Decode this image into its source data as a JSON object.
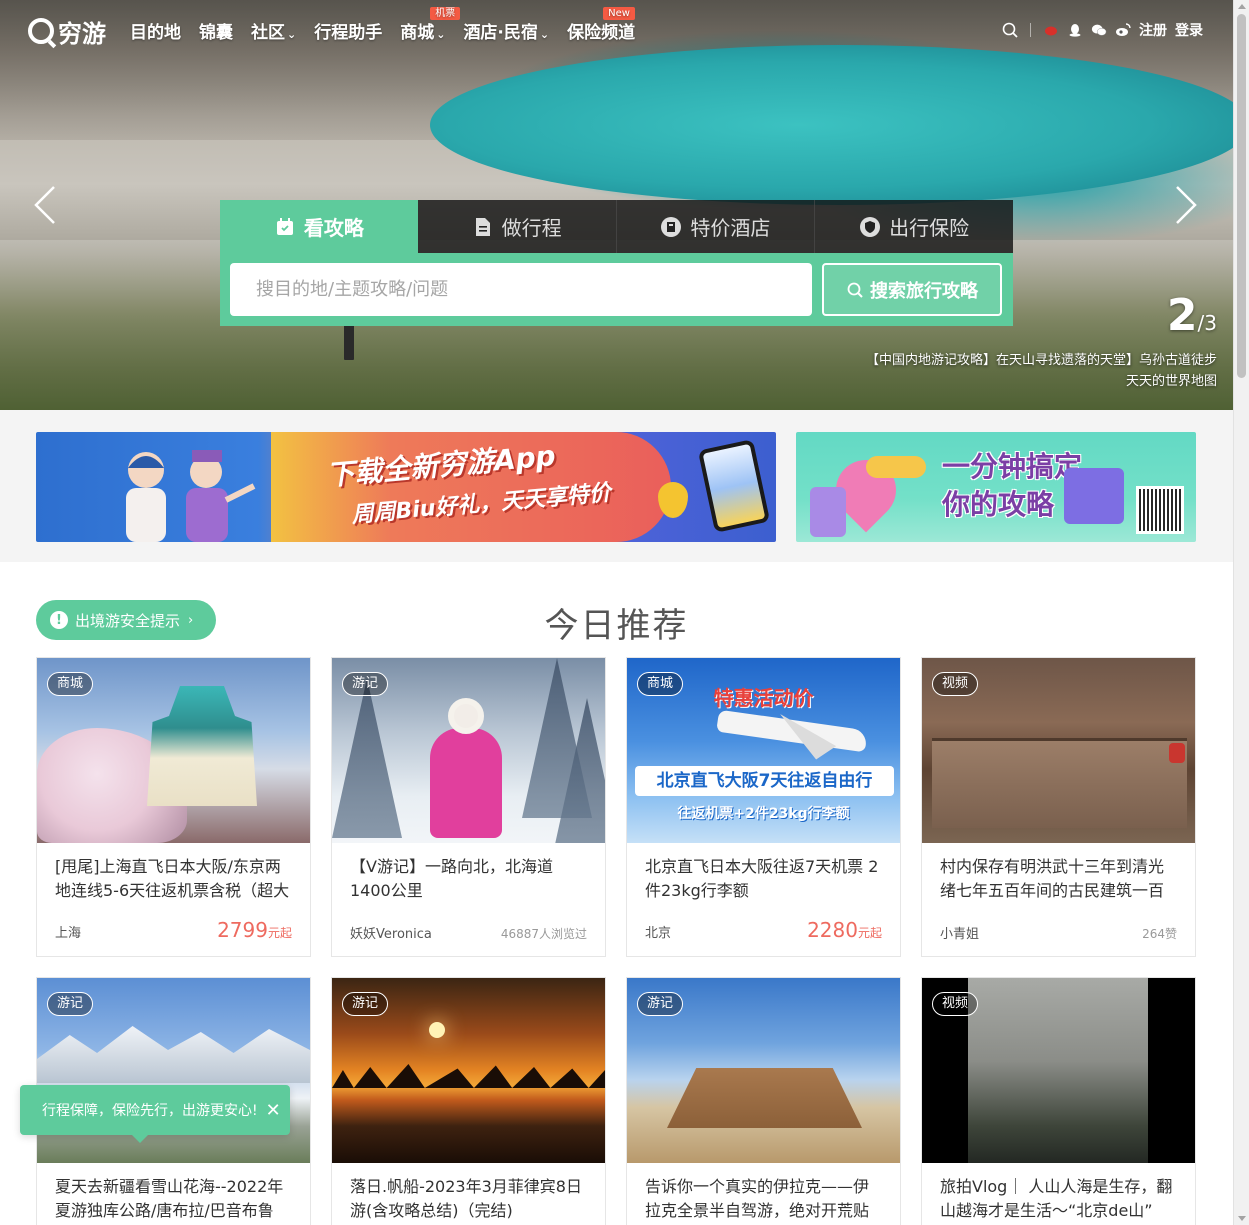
{
  "nav": {
    "logo": "穷游",
    "items": [
      {
        "label": "目的地",
        "badge": null,
        "dropdown": false
      },
      {
        "label": "锦囊",
        "badge": null,
        "dropdown": false
      },
      {
        "label": "社区",
        "badge": null,
        "dropdown": true
      },
      {
        "label": "行程助手",
        "badge": null,
        "dropdown": false
      },
      {
        "label": "商城",
        "badge": "机票",
        "dropdown": true
      },
      {
        "label": "酒店·民宿",
        "badge": null,
        "dropdown": true
      },
      {
        "label": "保险频道",
        "badge": "New",
        "dropdown": false
      }
    ],
    "register": "注册",
    "login": "登录"
  },
  "hero": {
    "tabs": [
      {
        "label": "看攻略",
        "icon": "guide-icon"
      },
      {
        "label": "做行程",
        "icon": "document-icon"
      },
      {
        "label": "特价酒店",
        "icon": "hotel-icon"
      },
      {
        "label": "出行保险",
        "icon": "shield-icon"
      }
    ],
    "search_placeholder": "搜目的地/主题攻略/问题",
    "search_button": "搜索旅行攻略",
    "slide_current": "2",
    "slide_total": "/3",
    "caption_line1": "【中国内地游记攻略】在天山寻找遗落的天堂】乌孙古道徒步",
    "caption_line2": "天天的世界地图"
  },
  "banners": {
    "app_title": "下载全新穷游App",
    "app_sub": "周周Biu好礼，天天享特价",
    "guide_title_1": "一分钟搞定",
    "guide_title_2": "你的攻略"
  },
  "main": {
    "safety_tip": "出境游安全提示",
    "section_title": "今日推荐"
  },
  "cards": [
    {
      "tag": "商城",
      "title": "[甩尾]上海直飞日本大阪/东京两地连线5-6天往返机票含税（超大",
      "left": "上海",
      "price": "2799",
      "unit": "元起",
      "stat": ""
    },
    {
      "tag": "游记",
      "title": "【V游记】一路向北，北海道1400公里",
      "left": "妖妖Veronica",
      "price": "",
      "unit": "",
      "stat": "46887人浏览过"
    },
    {
      "tag": "商城",
      "title": "北京直飞日本大阪往返7天机票 2件23kg行李额",
      "left": "北京",
      "price": "2280",
      "unit": "元起",
      "stat": "",
      "img_head": "特惠活动价",
      "img_band": "北京直飞大阪7天往返自由行",
      "img_sub": "往返机票+2件23kg行李额"
    },
    {
      "tag": "视频",
      "title": "村内保存有明洪武十三年到清光绪七年五百年间的古民建筑一百",
      "left": "小青姐",
      "price": "",
      "unit": "",
      "stat": "264赞"
    },
    {
      "tag": "游记",
      "title": "夏天去新疆看雪山花海--2022年夏游独库公路/唐布拉/巴音布鲁",
      "left": "",
      "price": "",
      "unit": "",
      "stat": ""
    },
    {
      "tag": "游记",
      "title": "落日.帆船-2023年3月菲律宾8日游(含攻略总结)（完结)",
      "left": "",
      "price": "",
      "unit": "",
      "stat": ""
    },
    {
      "tag": "游记",
      "title": "告诉你一个真实的伊拉克——伊拉克全景半自驾游，绝对开荒贴",
      "left": "",
      "price": "",
      "unit": "",
      "stat": ""
    },
    {
      "tag": "视频",
      "title": "旅拍Vlog｜ 人山人海是生存，翻山越海才是生活～“北京de山”",
      "left": "",
      "price": "",
      "unit": "",
      "stat": ""
    }
  ],
  "toast": {
    "text": "行程保障，保险先行，出游更安心!"
  },
  "colors": {
    "brand_green": "#5ecb9c",
    "price_red": "#ee6a5f",
    "badge_red": "#f45a43"
  }
}
